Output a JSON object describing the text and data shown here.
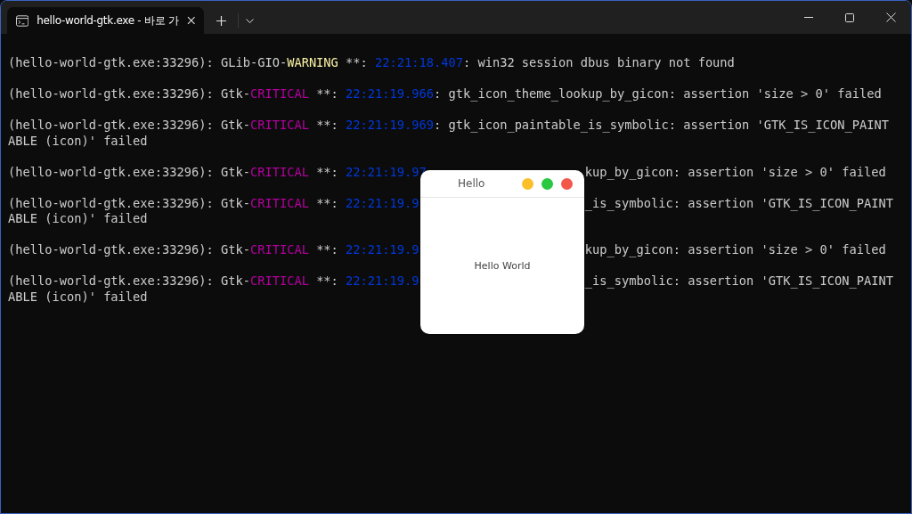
{
  "tab": {
    "title": "hello-world-gtk.exe - 바로 가",
    "selected": true
  },
  "log": [
    {
      "lines": [
        {
          "pieces": [
            {
              "kind": "left",
              "segments": [
                {
                  "kind": "plain",
                  "text": "(hello-world-gtk.exe:33296): GLib-GIO-"
                },
                {
                  "kind": "warning",
                  "text": "WARNING"
                },
                {
                  "kind": "plain",
                  "text": " **: "
                },
                {
                  "kind": "time",
                  "text": "22:21:18.407"
                },
                {
                  "kind": "plain",
                  "text": ": win32 session dbus binary not found"
                }
              ]
            }
          ]
        }
      ]
    },
    {
      "lines": [
        {
          "pieces": [
            {
              "kind": "left",
              "segments": [
                {
                  "kind": "plain",
                  "text": "(hello-world-gtk.exe:33296): Gtk-"
                },
                {
                  "kind": "critical",
                  "text": "CRITICAL"
                },
                {
                  "kind": "plain",
                  "text": " **: "
                },
                {
                  "kind": "time",
                  "text": "22:21:19.966"
                },
                {
                  "kind": "plain",
                  "text": ": gtk_icon_theme_lookup_by_gicon: assertion 'size > 0' failed"
                }
              ]
            }
          ]
        }
      ]
    },
    {
      "lines": [
        {
          "pieces": [
            {
              "kind": "left",
              "segments": [
                {
                  "kind": "plain",
                  "text": "(hello-world-gtk.exe:33296): Gtk-"
                },
                {
                  "kind": "critical",
                  "text": "CRITICAL"
                },
                {
                  "kind": "plain",
                  "text": " **: "
                },
                {
                  "kind": "time",
                  "text": "22:21:19.969"
                },
                {
                  "kind": "plain",
                  "text": ": gtk_icon_paintable_is_symbolic: assertion 'GTK_IS_ICON_PAINT"
                }
              ]
            }
          ]
        },
        {
          "pieces": [
            {
              "kind": "left",
              "segments": [
                {
                  "kind": "plain",
                  "text": "ABLE (icon)' failed"
                }
              ]
            }
          ]
        }
      ]
    },
    {
      "lines": [
        {
          "pieces": [
            {
              "kind": "left",
              "segments": [
                {
                  "kind": "plain",
                  "text": "(hello-world-gtk.exe:33296): Gtk-"
                },
                {
                  "kind": "critical",
                  "text": "CRITICAL"
                },
                {
                  "kind": "plain",
                  "text": " **: "
                },
                {
                  "kind": "time",
                  "text": "22:21:19.97"
                }
              ]
            },
            {
              "kind": "right",
              "segments": [
                {
                  "kind": "plain",
                  "text": "kup_by_gicon: assertion 'size > 0' failed"
                }
              ]
            }
          ]
        }
      ]
    },
    {
      "lines": [
        {
          "pieces": [
            {
              "kind": "left",
              "segments": [
                {
                  "kind": "plain",
                  "text": "(hello-world-gtk.exe:33296): Gtk-"
                },
                {
                  "kind": "critical",
                  "text": "CRITICAL"
                },
                {
                  "kind": "plain",
                  "text": " **: "
                },
                {
                  "kind": "time",
                  "text": "22:21:19.9"
                }
              ]
            },
            {
              "kind": "right",
              "segments": [
                {
                  "kind": "plain",
                  "text": "_is_symbolic: assertion 'GTK_IS_ICON_PAINT"
                }
              ]
            }
          ]
        },
        {
          "pieces": [
            {
              "kind": "left",
              "segments": [
                {
                  "kind": "plain",
                  "text": "ABLE (icon)' failed"
                }
              ]
            }
          ]
        }
      ]
    },
    {
      "lines": [
        {
          "pieces": [
            {
              "kind": "left",
              "segments": [
                {
                  "kind": "plain",
                  "text": "(hello-world-gtk.exe:33296): Gtk-"
                },
                {
                  "kind": "critical",
                  "text": "CRITICAL"
                },
                {
                  "kind": "plain",
                  "text": " **: "
                },
                {
                  "kind": "time",
                  "text": "22:21:19.9"
                }
              ]
            },
            {
              "kind": "right",
              "segments": [
                {
                  "kind": "plain",
                  "text": "kup_by_gicon: assertion 'size > 0' failed"
                }
              ]
            }
          ]
        }
      ]
    },
    {
      "lines": [
        {
          "pieces": [
            {
              "kind": "left",
              "segments": [
                {
                  "kind": "plain",
                  "text": "(hello-world-gtk.exe:33296): Gtk-"
                },
                {
                  "kind": "critical",
                  "text": "CRITICAL"
                },
                {
                  "kind": "plain",
                  "text": " **: "
                },
                {
                  "kind": "time",
                  "text": "22:21:19.9"
                }
              ]
            },
            {
              "kind": "right",
              "segments": [
                {
                  "kind": "plain",
                  "text": "_is_symbolic: assertion 'GTK_IS_ICON_PAINT"
                }
              ]
            }
          ]
        },
        {
          "pieces": [
            {
              "kind": "left",
              "segments": [
                {
                  "kind": "plain",
                  "text": "ABLE (icon)' failed"
                }
              ]
            }
          ]
        }
      ]
    }
  ],
  "dialog": {
    "title": "Hello",
    "label": "Hello World"
  }
}
